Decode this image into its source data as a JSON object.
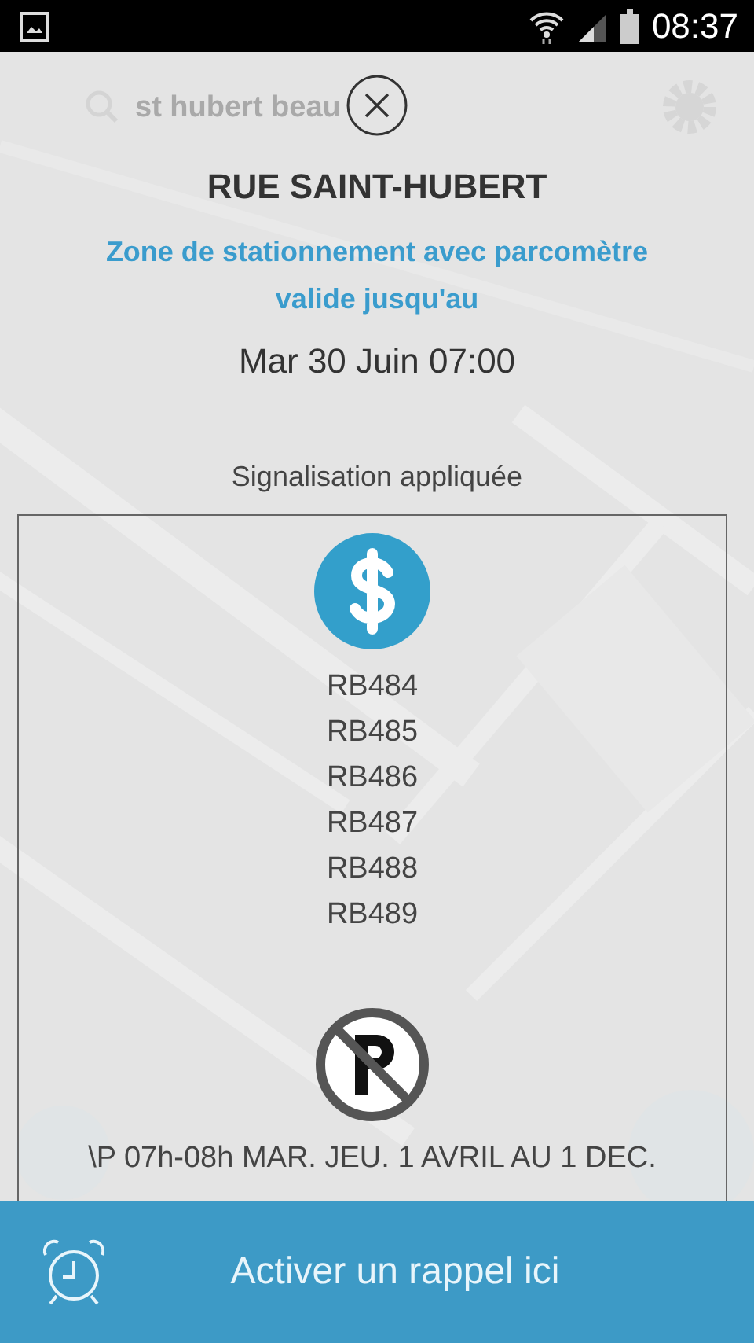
{
  "status_bar": {
    "time": "08:37"
  },
  "search": {
    "value": "st hubert beau"
  },
  "popup": {
    "title": "RUE SAINT-HUBERT",
    "subtitle": "Zone de stationnement avec parcomètre valide jusqu'au",
    "date": "Mar 30 Juin 07:00",
    "section_label": "Signalisation appliquée",
    "signs": [
      {
        "kind": "meter",
        "lines": [
          "RB484",
          "RB485",
          "RB486",
          "RB487",
          "RB488",
          "RB489"
        ]
      },
      {
        "kind": "no_parking",
        "lines": [
          "\\P 07h-08h MAR. JEU. 1 AVRIL AU 1 DEC."
        ]
      }
    ]
  },
  "action": {
    "label": "Activer un rappel ici"
  }
}
